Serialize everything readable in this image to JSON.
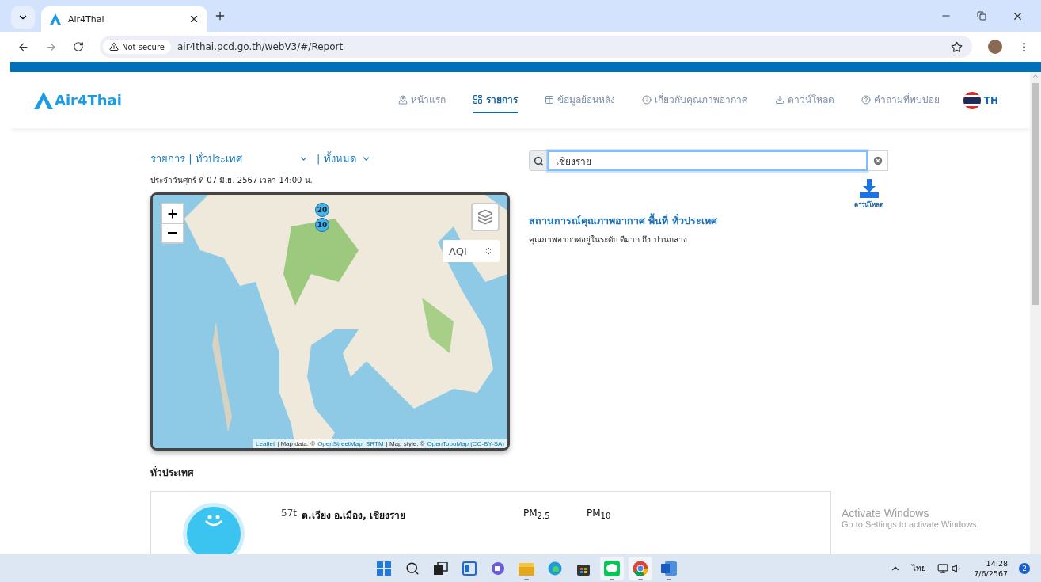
{
  "browser": {
    "tabs": [
      {
        "title": "Air4Thai",
        "selected": true
      }
    ],
    "security": "Not secure",
    "url": "air4thai.pcd.go.th/webV3/#/Report"
  },
  "site": {
    "logo": "Air4Thai",
    "language": {
      "label": "TH",
      "selected": true
    },
    "nav": [
      {
        "label": "หน้าแรก",
        "kind": "home",
        "selected": false
      },
      {
        "label": "รายการ",
        "kind": "list",
        "selected": true
      },
      {
        "label": "ข้อมูลย้อนหลัง",
        "kind": "table",
        "selected": false
      },
      {
        "label": "เกี่ยวกับคุณภาพอากาศ",
        "kind": "info",
        "selected": false
      },
      {
        "label": "ดาวน์โหลด",
        "kind": "download",
        "selected": false
      },
      {
        "label": "คำถามที่พบบ่อย",
        "kind": "help",
        "selected": false
      }
    ]
  },
  "filters": [
    {
      "label": "รายการ | ทั่วประเทศ"
    },
    {
      "label": "| ทั้งหมด"
    }
  ],
  "date": "ประจำวันศุกร์ ที่ 07 มิ.ย. 2567 เวลา 14:00 น.",
  "map": {
    "markers": [
      {
        "label": "20"
      },
      {
        "label": "10"
      }
    ],
    "layer": "AQI",
    "attribution": [
      {
        "text": "Leaflet",
        "kind": "link"
      },
      {
        "text": "| Map data: ©",
        "kind": "text"
      },
      {
        "text": "OpenStreetMap, SRTM",
        "kind": "link"
      },
      {
        "text": "| Map style: ©",
        "kind": "text"
      },
      {
        "text": "OpenTopoMap (CC-BY-SA)",
        "kind": "link"
      }
    ]
  },
  "search": {
    "value": "เชียงราย"
  },
  "download": "ดาวน์โหลด",
  "summary": {
    "title": "สถานการณ์คุณภาพอากาศ พื้นที่ ทั่วประเทศ",
    "text": "คุณภาพอากาศอยู่ในระดับ ดีมาก ถึง ปานกลาง"
  },
  "section_title": "ทั่วประเทศ",
  "stations": [
    {
      "code": "57t",
      "name": "ต.เวียง อ.เมือง, เชียงราย",
      "color": "#3cc4f0"
    }
  ],
  "pollutants": [
    "PM$_{2.5}$",
    "PM$_{10}$"
  ],
  "windows_notice": {
    "title": "Activate Windows",
    "text": "Go to Settings to activate Windows."
  },
  "taskbar": {
    "apps": [
      {
        "kind": "start",
        "running": false
      },
      {
        "kind": "search",
        "running": false
      },
      {
        "kind": "taskview",
        "running": false
      },
      {
        "kind": "widgets",
        "running": false
      },
      {
        "kind": "chat",
        "running": false
      },
      {
        "kind": "explorer",
        "running": true
      },
      {
        "kind": "edge",
        "running": false
      },
      {
        "kind": "store",
        "running": false
      },
      {
        "kind": "line",
        "running": true
      },
      {
        "kind": "chrome",
        "running": true
      },
      {
        "kind": "word",
        "running": true
      }
    ],
    "language": "ไทย",
    "time": "14:28",
    "date": "7/6/2567",
    "notifications": "2"
  }
}
